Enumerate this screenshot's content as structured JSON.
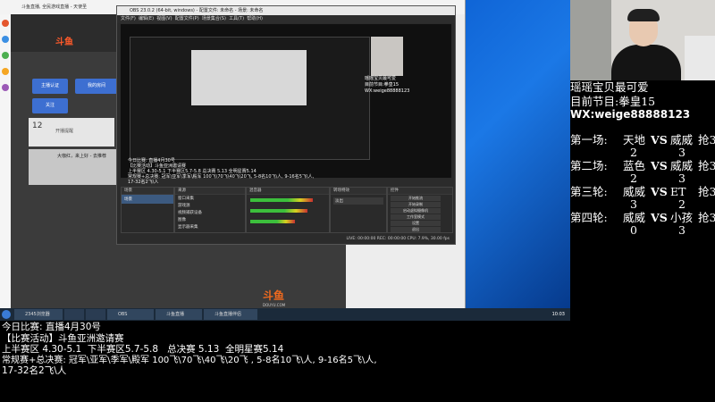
{
  "browser": {
    "title": "斗鱼直播, 全民游戏直播 - 天使圣",
    "tab_label": "斗鱼直播"
  },
  "douyu": {
    "logo_top": "斗鱼",
    "follow_label": "关注",
    "btn_1": "主播认证",
    "btn_2": "我的房间",
    "card_label": "开播提醒",
    "card2_text": "大咖红，来上好 - 去推荐",
    "logo_bottom": "斗鱼",
    "logo_sub": "DOUYU.COM"
  },
  "obs": {
    "title": "OBS 23.0.2 (64-bit, windows) - 配置文件: 未命名 - 场景: 未命名",
    "menu": [
      "文件(F)",
      "编辑(E)",
      "视图(V)",
      "配置文件(P)",
      "场景集合(S)",
      "工具(T)",
      "帮助(H)"
    ],
    "docks": {
      "scenes": "场景",
      "sources": "来源",
      "mixer": "混音器",
      "transitions": "转场特效",
      "controls": "控件"
    },
    "scene_item": "场景",
    "sources_items": [
      "窗口采集",
      "游戏源",
      "视频捕获设备",
      "图像",
      "显示器采集"
    ],
    "controls_items": [
      "开始推流",
      "开始录制",
      "启动虚拟摄像机",
      "工作室模式",
      "设置",
      "退出"
    ],
    "transition": "淡出",
    "status": "LIVE: 00:00:00   REC: 00:00:00   CPU: 7.9%, 30.00 fps",
    "chat_lines": [
      "今日比赛: 直播4月30号",
      "【比赛活动】斗鱼亚洲邀请赛",
      "上半赛区 4.30-5.1  下半赛区5.7-5.8  总决赛 5.13 全明星赛5.14",
      "常规赛+总决赛: 冠军\\亚军\\季军\\殿军 100飞\\70飞\\40飞\\20飞, 5-8名10飞\\人, 9-16名5飞\\人,",
      "17-32名2飞\\人"
    ]
  },
  "taskbar": {
    "items": [
      "2345浏览器",
      "",
      "",
      "OBS",
      "斗鱼直播",
      "斗鱼直播伴侣"
    ],
    "time": "10:03"
  },
  "overlay": {
    "line1": "瑶瑶宝贝最可爱",
    "line2": "目前节目:拳皇15",
    "line3": "WX:weige88888123",
    "matches": [
      {
        "label": "第一场:",
        "a": "天地",
        "vs": "VS",
        "b": "威威",
        "tail": "抢3",
        "sa": "2",
        "sb": "3"
      },
      {
        "label": "第二场:",
        "a": "蓝色",
        "vs": "VS",
        "b": "威威",
        "tail": "抢3",
        "sa": "2",
        "sb": "3"
      },
      {
        "label": "第三轮:",
        "a": "威威",
        "vs": "VS",
        "b": "ET",
        "tail": "抢3",
        "sa": "3",
        "sb": "2"
      },
      {
        "label": "第四轮:",
        "a": "威威",
        "vs": "VS",
        "b": "小孩",
        "tail": "抢3",
        "sa": "0",
        "sb": "3"
      }
    ]
  },
  "bottom": {
    "line1": "今日比赛: 直播4月30号",
    "line2": "【比赛活动】斗鱼亚洲邀请赛",
    "line3": "上半赛区 4.30-5.1  下半赛区5.7-5.8   总决赛 5.13  全明星赛5.14",
    "line4": "常规赛+总决赛: 冠军\\亚军\\季军\\殿军 100飞\\70飞\\40飞\\20飞 , 5-8名10飞\\人, 9-16名5飞\\人,",
    "line5": "17-32名2飞\\人"
  }
}
